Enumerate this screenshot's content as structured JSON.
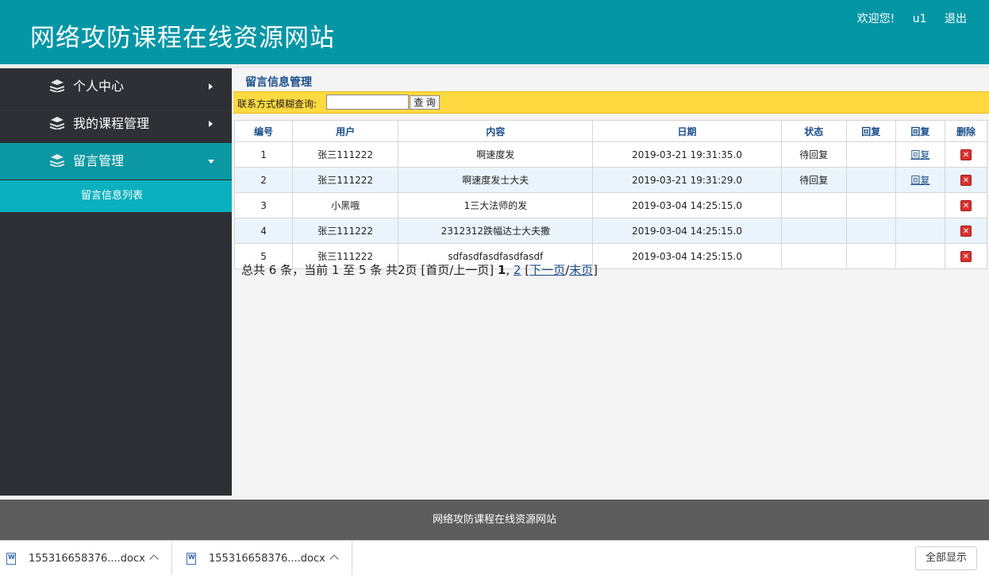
{
  "header": {
    "title": "网络攻防课程在线资源网站",
    "welcome": "欢迎您!",
    "username": "u1",
    "logout": "退出"
  },
  "sidebar": {
    "items": [
      {
        "label": "个人中心",
        "icon": "stack-icon",
        "state": "collapsed"
      },
      {
        "label": "我的课程管理",
        "icon": "stack-icon",
        "state": "collapsed"
      },
      {
        "label": "留言管理",
        "icon": "stack-icon",
        "state": "expanded"
      }
    ],
    "submenu": [
      "留言信息列表"
    ]
  },
  "main": {
    "title": "留言信息管理",
    "search": {
      "label": "联系方式模糊查询:",
      "value": "",
      "button": "查 询"
    },
    "table": {
      "headers": [
        "编号",
        "用户",
        "内容",
        "日期",
        "状态",
        "回复",
        "回复",
        "删除"
      ],
      "rows": [
        {
          "id": "1",
          "user": "张三111222",
          "content": "啊速度发",
          "date": "2019-03-21 19:31:35.0",
          "status": "待回复",
          "reply_text": "",
          "reply_link": "回复"
        },
        {
          "id": "2",
          "user": "张三111222",
          "content": "啊速度发士大夫",
          "date": "2019-03-21 19:31:29.0",
          "status": "待回复",
          "reply_text": "",
          "reply_link": "回复"
        },
        {
          "id": "3",
          "user": "小黑哦",
          "content": "1三大法师的发",
          "date": "2019-03-04 14:25:15.0",
          "status": "",
          "reply_text": "",
          "reply_link": ""
        },
        {
          "id": "4",
          "user": "张三111222",
          "content": "2312312跌幅达士大夫撒",
          "date": "2019-03-04 14:25:15.0",
          "status": "",
          "reply_text": "",
          "reply_link": ""
        },
        {
          "id": "5",
          "user": "张三111222",
          "content": "sdfasdfasdfasdfasdf",
          "date": "2019-03-04 14:25:15.0",
          "status": "",
          "reply_text": "",
          "reply_link": ""
        }
      ]
    },
    "pager": {
      "summary": "总共 6 条，当前 1 至 5 条 共2页",
      "first_prev": "[首页/上一页]",
      "page1": "1",
      "comma": ",",
      "page2": "2",
      "open_bracket": "[",
      "next": "下一页",
      "slash": "/",
      "last": "末页",
      "close_bracket": "]"
    }
  },
  "footer": {
    "text": "网络攻防课程在线资源网站"
  },
  "downloads": {
    "items": [
      {
        "name": "155316658376....docx",
        "icon": "word-file-icon"
      },
      {
        "name": "155316658376....docx",
        "icon": "word-file-icon"
      }
    ],
    "show_all": "全部显示"
  },
  "colors": {
    "header_bg": "#0596a6",
    "sidebar_bg": "#2f3035",
    "active_item": "#0c98a3",
    "submenu_bg": "#0ab0be",
    "search_bar": "#ffd940",
    "footer_bg": "#5d5d5d",
    "delete_red": "#d9302f"
  }
}
